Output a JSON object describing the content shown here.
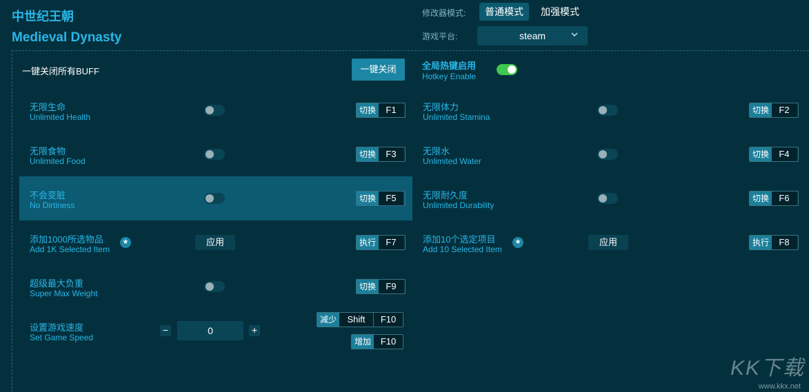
{
  "header": {
    "title_cn": "中世纪王朝",
    "title_en": "Medieval Dynasty",
    "mode_label": "修改器模式:",
    "mode_normal": "普通模式",
    "mode_enhanced": "加强模式",
    "platform_label": "游戏平台:",
    "platform_value": "steam"
  },
  "global": {
    "buff_label": "一键关闭所有BUFF",
    "close_all": "一键关闭",
    "hotkey_cn": "全局热键启用",
    "hotkey_en": "Hotkey Enable"
  },
  "cheats": [
    {
      "cn": "无限生命",
      "en": "Unlimited Health",
      "action": "切换",
      "key": "F1"
    },
    {
      "cn": "无限体力",
      "en": "Unlimited Stamina",
      "action": "切换",
      "key": "F2"
    },
    {
      "cn": "无限食物",
      "en": "Unlimited Food",
      "action": "切换",
      "key": "F3"
    },
    {
      "cn": "无限水",
      "en": "Unlimited Water",
      "action": "切换",
      "key": "F4"
    },
    {
      "cn": "不会变脏",
      "en": "No Dirtiness",
      "action": "切换",
      "key": "F5"
    },
    {
      "cn": "无限耐久度",
      "en": "Unlimited Durability",
      "action": "切换",
      "key": "F6"
    },
    {
      "cn": "添加1000所选物品",
      "en": "Add 1K Selected Item",
      "action": "执行",
      "key": "F7",
      "apply": "应用"
    },
    {
      "cn": "添加10个选定项目",
      "en": "Add 10 Selected Item",
      "action": "执行",
      "key": "F8",
      "apply": "应用"
    },
    {
      "cn": "超级最大负重",
      "en": "Super Max Weight",
      "action": "切换",
      "key": "F9"
    }
  ],
  "speed": {
    "cn": "设置游戏速度",
    "en": "Set Game Speed",
    "value": "0",
    "minus": "−",
    "plus": "+",
    "dec_action": "减少",
    "dec_mod": "Shift",
    "dec_key": "F10",
    "inc_action": "增加",
    "inc_key": "F10"
  },
  "watermark": {
    "logo": "KK下载",
    "url": "www.kkx.net"
  },
  "colors": {
    "background": "#04303d",
    "accent": "#29b6e8",
    "highlight_row": "#0c5b73",
    "toggle_on": "#3fc84e"
  }
}
